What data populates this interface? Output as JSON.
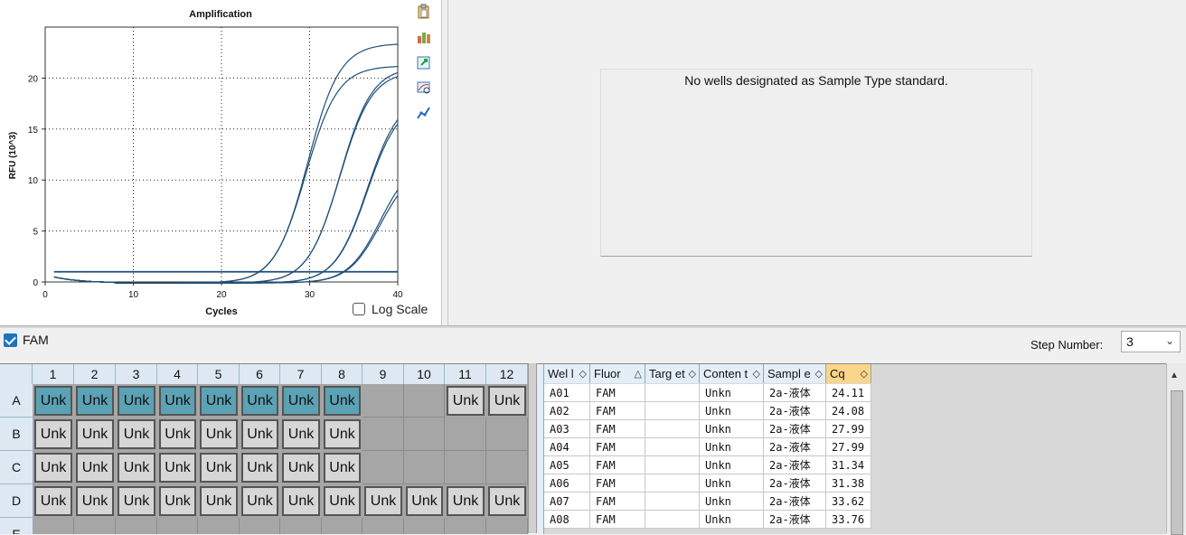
{
  "chart": {
    "title": "Amplification",
    "xlabel": "Cycles",
    "ylabel": "RFU (10^3)",
    "x_ticks": [
      "0",
      "10",
      "20",
      "30",
      "40"
    ],
    "y_ticks": [
      "0",
      "5",
      "10",
      "15",
      "20"
    ],
    "log_scale_label": "Log Scale"
  },
  "chart_data": {
    "type": "line",
    "title": "Amplification",
    "xlabel": "Cycles",
    "ylabel": "RFU (10^3)",
    "xlim": [
      0,
      40
    ],
    "ylim": [
      0,
      25
    ],
    "grid": true,
    "threshold": 1.0,
    "series": [
      {
        "cq": 24.11,
        "plateau": 23.5
      },
      {
        "cq": 24.08,
        "plateau": 21.3
      },
      {
        "cq": 27.99,
        "plateau": 21.2
      },
      {
        "cq": 27.99,
        "plateau": 20.8
      },
      {
        "cq": 31.34,
        "plateau": 18.4
      },
      {
        "cq": 31.38,
        "plateau": 17.9
      },
      {
        "cq": 33.62,
        "plateau": 12.2
      },
      {
        "cq": 33.76,
        "plateau": 11.5
      }
    ]
  },
  "side_icons": [
    "clipboard-icon",
    "chart-settings-icon",
    "export-icon",
    "zoom-chart-icon",
    "trace-icon"
  ],
  "standard_message": "No wells designated as Sample Type standard.",
  "fluor_checkbox": {
    "label": "FAM",
    "checked": true
  },
  "step": {
    "label": "Step Number:",
    "value": "3"
  },
  "plate": {
    "columns": [
      "1",
      "2",
      "3",
      "4",
      "5",
      "6",
      "7",
      "8",
      "9",
      "10",
      "11",
      "12"
    ],
    "rows": [
      {
        "label": "A",
        "cells": [
          "Unk",
          "Unk",
          "Unk",
          "Unk",
          "Unk",
          "Unk",
          "Unk",
          "Unk",
          "",
          "",
          "Unk",
          "Unk"
        ],
        "states": [
          "teal",
          "teal",
          "teal",
          "teal",
          "teal",
          "teal",
          "teal",
          "teal",
          "empty",
          "empty",
          "grey",
          "grey"
        ]
      },
      {
        "label": "B",
        "cells": [
          "Unk",
          "Unk",
          "Unk",
          "Unk",
          "Unk",
          "Unk",
          "Unk",
          "Unk",
          "",
          "",
          "",
          ""
        ],
        "states": [
          "grey",
          "grey",
          "grey",
          "grey",
          "grey",
          "grey",
          "grey",
          "grey",
          "empty",
          "empty",
          "empty",
          "empty"
        ]
      },
      {
        "label": "C",
        "cells": [
          "Unk",
          "Unk",
          "Unk",
          "Unk",
          "Unk",
          "Unk",
          "Unk",
          "Unk",
          "",
          "",
          "",
          ""
        ],
        "states": [
          "grey",
          "grey",
          "grey",
          "grey",
          "grey",
          "grey",
          "grey",
          "grey",
          "empty",
          "empty",
          "empty",
          "empty"
        ]
      },
      {
        "label": "D",
        "cells": [
          "Unk",
          "Unk",
          "Unk",
          "Unk",
          "Unk",
          "Unk",
          "Unk",
          "Unk",
          "Unk",
          "Unk",
          "Unk",
          "Unk"
        ],
        "states": [
          "grey",
          "grey",
          "grey",
          "grey",
          "grey",
          "grey",
          "grey",
          "grey",
          "grey",
          "grey",
          "grey",
          "grey"
        ]
      },
      {
        "label": "E",
        "cells": [
          "",
          "",
          "",
          "",
          "",
          "",
          "",
          "",
          "",
          "",
          "",
          ""
        ],
        "states": [
          "empty",
          "empty",
          "empty",
          "empty",
          "empty",
          "empty",
          "empty",
          "empty",
          "empty",
          "empty",
          "empty",
          "empty"
        ]
      }
    ]
  },
  "table": {
    "headers": [
      "Wel l",
      "Fluor",
      "Targ et",
      "Conten t",
      "Sampl e",
      "Cq"
    ],
    "rows": [
      [
        "A01",
        "FAM",
        "",
        "Unkn",
        "2a-液体",
        "24.11"
      ],
      [
        "A02",
        "FAM",
        "",
        "Unkn",
        "2a-液体",
        "24.08"
      ],
      [
        "A03",
        "FAM",
        "",
        "Unkn",
        "2a-液体",
        "27.99"
      ],
      [
        "A04",
        "FAM",
        "",
        "Unkn",
        "2a-液体",
        "27.99"
      ],
      [
        "A05",
        "FAM",
        "",
        "Unkn",
        "2a-液体",
        "31.34"
      ],
      [
        "A06",
        "FAM",
        "",
        "Unkn",
        "2a-液体",
        "31.38"
      ],
      [
        "A07",
        "FAM",
        "",
        "Unkn",
        "2a-液体",
        "33.62"
      ],
      [
        "A08",
        "FAM",
        "",
        "Unkn",
        "2a-液体",
        "33.76"
      ]
    ]
  },
  "colors": {
    "curve": "#1f4e79",
    "teal_well": "#5ba2b4",
    "cq_header": "#fbd58a",
    "checkbox": "#1e73be"
  }
}
